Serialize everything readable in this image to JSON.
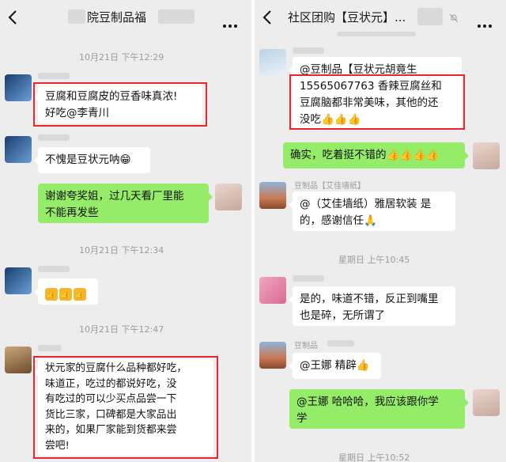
{
  "left": {
    "title": "院豆制品福",
    "times": [
      "10月21日 下午12:29",
      "10月21日 下午12:34",
      "10月21日 下午12:47"
    ],
    "messages": [
      {
        "lines": [
          "豆腐和豆腐皮的豆香味真浓!",
          "好吃@李青川"
        ]
      },
      {
        "lines": [
          "不愧是豆状元呐😁"
        ]
      },
      {
        "lines": [
          "谢谢夸奖姐，过几天看厂里能",
          "不能再发些"
        ]
      },
      {
        "emoji": [
          "👍",
          "👍",
          "👍"
        ]
      },
      {
        "lines": [
          "状元家的豆腐什么品种都好吃，",
          "味道正，吃过的都说好吃，没",
          "有吃过的可以少买点品尝一下",
          "货比三家，口碑都是大家品出",
          "来的，如果厂家能到货都来尝",
          "尝吧!"
        ]
      }
    ]
  },
  "right": {
    "title": "社区团购【豆状元】...",
    "sender_names": [
      "豆制品【艾佳墙纸】",
      "豆制品"
    ],
    "times": [
      "星期日 上午10:45",
      "星期日 上午10:52"
    ],
    "messages": [
      {
        "lines": [
          "@豆制品【豆状元胡竟生",
          "15565067763   香辣豆腐丝和",
          "豆腐脑都非常美味，其他的还",
          "没吃👍👍👍"
        ]
      },
      {
        "lines": [
          "确实，吃着挺不错的👍👍👍👍"
        ]
      },
      {
        "lines": [
          "@（艾佳墙纸）雅居软装 是",
          "的，感谢信任🙏"
        ]
      },
      {
        "lines": [
          "是的，味道不错，反正到嘴里",
          "也是碎，无所谓了"
        ]
      },
      {
        "lines": [
          "@王娜 精辟👍"
        ]
      },
      {
        "lines": [
          "@王娜 哈哈哈，我应该跟你学",
          "学"
        ]
      }
    ]
  },
  "colors": {
    "highlight": "#e6282b",
    "green_bubble": "#95ec69"
  }
}
